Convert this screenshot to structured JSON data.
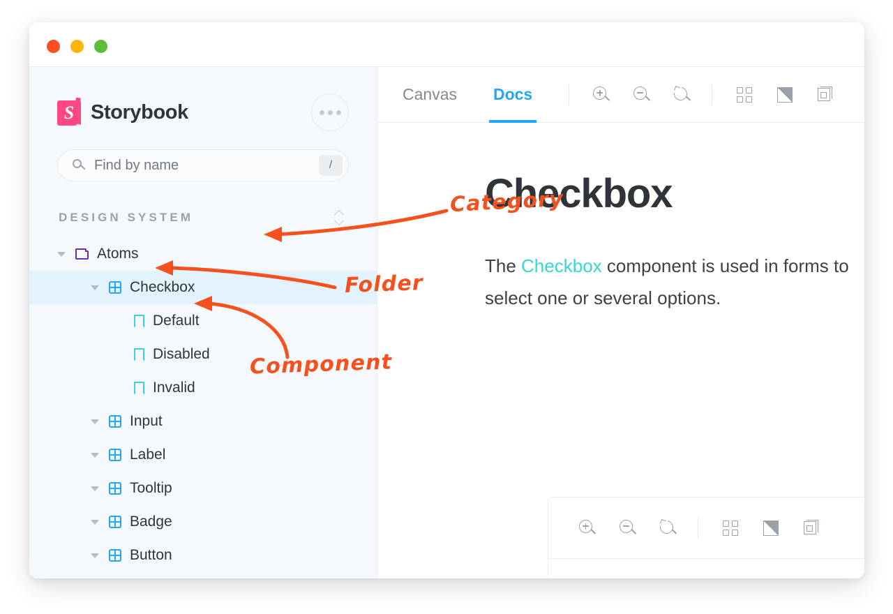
{
  "window": {
    "traffic_lights": [
      {
        "name": "close",
        "color": "#fc4f21"
      },
      {
        "name": "minimize",
        "color": "#ffb60a"
      },
      {
        "name": "maximize",
        "color": "#5cbc3c"
      }
    ]
  },
  "sidebar": {
    "brand": "Storybook",
    "logo_color": "#ff4785",
    "more_menu_label": "•••",
    "search": {
      "placeholder": "Find by name",
      "value": "",
      "shortcut_key": "/"
    },
    "section": {
      "title": "DESIGN SYSTEM",
      "sort_icon": "sort-chevrons-icon"
    },
    "tree": [
      {
        "label": "Atoms",
        "type": "folder",
        "depth": 0,
        "expanded": true,
        "selected": false,
        "icon_color": "#6f2cac"
      },
      {
        "label": "Checkbox",
        "type": "component",
        "depth": 1,
        "expanded": true,
        "selected": true,
        "icon_color": "#1ea7fd"
      },
      {
        "label": "Default",
        "type": "story",
        "depth": 2,
        "expanded": false,
        "selected": false,
        "icon_color": "#37d5d3"
      },
      {
        "label": "Disabled",
        "type": "story",
        "depth": 2,
        "expanded": false,
        "selected": false,
        "icon_color": "#37d5d3"
      },
      {
        "label": "Invalid",
        "type": "story",
        "depth": 2,
        "expanded": false,
        "selected": false,
        "icon_color": "#37d5d3"
      },
      {
        "label": "Input",
        "type": "component",
        "depth": 1,
        "expanded": true,
        "selected": false,
        "icon_color": "#1ea7fd"
      },
      {
        "label": "Label",
        "type": "component",
        "depth": 1,
        "expanded": true,
        "selected": false,
        "icon_color": "#1ea7fd"
      },
      {
        "label": "Tooltip",
        "type": "component",
        "depth": 1,
        "expanded": true,
        "selected": false,
        "icon_color": "#1ea7fd"
      },
      {
        "label": "Badge",
        "type": "component",
        "depth": 1,
        "expanded": true,
        "selected": false,
        "icon_color": "#1ea7fd"
      },
      {
        "label": "Button",
        "type": "component",
        "depth": 1,
        "expanded": true,
        "selected": false,
        "icon_color": "#1ea7fd"
      }
    ]
  },
  "main": {
    "tabs": [
      {
        "label": "Canvas",
        "active": false
      },
      {
        "label": "Docs",
        "active": true
      }
    ],
    "active_tab_color": "#1ea7fd",
    "toolbar_icons": [
      "zoom-in-icon",
      "zoom-out-icon",
      "zoom-reset-icon",
      "grid-icon",
      "contrast-icon",
      "layers-icon"
    ],
    "doc": {
      "title": "Checkbox",
      "paragraph_before": "The ",
      "paragraph_link": "Checkbox",
      "paragraph_after": " component is used in forms to select one or several options."
    },
    "preview_toolbar_icons": [
      "zoom-in-icon",
      "zoom-out-icon",
      "zoom-reset-icon",
      "grid-icon",
      "contrast-icon",
      "layers-icon"
    ]
  },
  "annotations": {
    "color": "#f4511e",
    "items": [
      {
        "id": "category",
        "text": "Category",
        "points_to": "DESIGN SYSTEM"
      },
      {
        "id": "folder",
        "text": "Folder",
        "points_to": "Atoms"
      },
      {
        "id": "component",
        "text": "Component",
        "points_to": "Checkbox"
      }
    ]
  }
}
